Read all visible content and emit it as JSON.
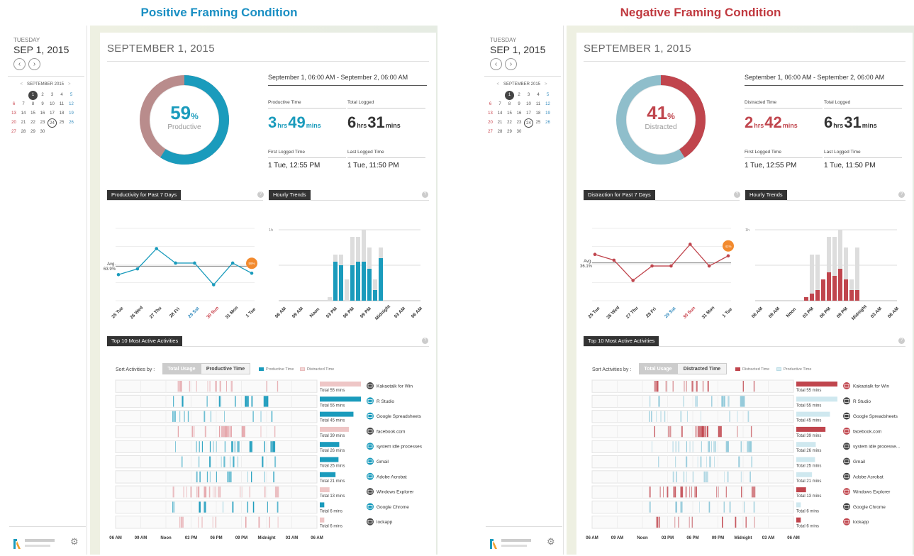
{
  "shared": {
    "day": "TUESDAY",
    "date": "SEP 1, 2015",
    "prev_icon": "‹",
    "next_icon": "›",
    "calendar": {
      "month_label": "SEPTEMBER 2015",
      "prev": "<",
      "next": ">",
      "today": 1,
      "selected": 24,
      "days": [
        1,
        2,
        3,
        4,
        5,
        6,
        7,
        8,
        9,
        10,
        11,
        12,
        13,
        14,
        15,
        16,
        17,
        18,
        19,
        20,
        21,
        22,
        23,
        24,
        25,
        26,
        27,
        28,
        29,
        30
      ],
      "start_col": 2
    },
    "main_title": "SEPTEMBER 1, 2015",
    "range": "September 1, 06:00 AM - September 2, 06:00 AM",
    "total_logged_label": "Total Logged",
    "total_logged": {
      "h": "6",
      "hl": "hrs",
      "m": "31",
      "ml": "mins"
    },
    "first_label": "First Logged Time",
    "first_value": "1 Tue, 12:55 PM",
    "last_label": "Last Logged Time",
    "last_value": "1 Tue, 11:50 PM",
    "hourly_title": "Hourly Trends",
    "top_title": "Top 10 Most Active Activities",
    "sort_label": "Sort Activities by :",
    "sort_total": "Total Usage",
    "week_days": [
      "25 Tue",
      "26 Wed",
      "27 Thu",
      "28 Fri",
      "29 Sat",
      "30 Sun",
      "31 Mon",
      "1 Tue"
    ],
    "hour_ticks": [
      "06 AM",
      "09 AM",
      "Noon",
      "03 PM",
      "06 PM",
      "09 PM",
      "Midnight",
      "03 AM",
      "06 AM"
    ],
    "hour_max_label": "1h",
    "help_icon": "?",
    "gear_icon": "⚙",
    "app_names": [
      "Kakaotalk for Win",
      "R Studio",
      "Google Spreadsheets",
      "facebook.com",
      "system idle processes",
      "Gmail",
      "Adobe Acrobat",
      "Windows Explorer",
      "Google Chrome",
      "lockapp"
    ],
    "app_names_negative_display": [
      "Kakaotalk for Win",
      "R Studio",
      "Google Spreadsheets",
      "facebook.com",
      "system idle processe...",
      "Gmail",
      "Adobe Acrobat",
      "Windows Explorer",
      "Google Chrome",
      "lockapp"
    ],
    "totals": [
      "Total 55 mins",
      "Total 55 mins",
      "Total 45 mins",
      "Total 39 mins",
      "Total 26 mins",
      "Total 25 mins",
      "Total 21 mins",
      "Total 13 mins",
      "Total 6 mins",
      "Total 6 mins"
    ],
    "app_productive": [
      false,
      true,
      true,
      false,
      true,
      true,
      true,
      false,
      true,
      false
    ]
  },
  "positive": {
    "condition_title": "Positive Framing Condition",
    "color": "#1a9bbc",
    "other_color": "#b98c8c",
    "pct": "59",
    "pct_label": "Productive",
    "primary_label": "Productive Time",
    "primary": {
      "h": "3",
      "hl": "hrs",
      "m": "49",
      "ml": "mins"
    },
    "week_title": "Productivity for Past 7 Days",
    "avg_label": "Avg.",
    "avg_value": "63.9%",
    "marker_label": "59%",
    "sort_alt": "Productive Time",
    "legend_main": "Productive Time",
    "legend_alt": "Distracted Time"
  },
  "negative": {
    "condition_title": "Negative Framing Condition",
    "color": "#c0454d",
    "other_color": "#8fbecb",
    "pct": "41",
    "pct_label": "Distracted",
    "primary_label": "Distracted Time",
    "primary": {
      "h": "2",
      "hl": "hrs",
      "m": "42",
      "ml": "mins"
    },
    "week_title": "Distraction for Past 7 Days",
    "avg_label": "Avg.",
    "avg_value": "36.1%",
    "marker_label": "41%",
    "sort_alt": "Distracted Time",
    "legend_main": "Distracted Time",
    "legend_alt": "Productive Time"
  },
  "chart_data": [
    {
      "type": "line",
      "title": "Productivity for Past 7 Days",
      "x": [
        "25 Tue",
        "26 Wed",
        "27 Thu",
        "28 Fri",
        "29 Sat",
        "30 Sun",
        "31 Mon",
        "1 Tue"
      ],
      "y": [
        58,
        62,
        76,
        66,
        66,
        51,
        66,
        59
      ],
      "ylim": [
        40,
        90
      ],
      "avg": 63.9
    },
    {
      "type": "line",
      "title": "Distraction for Past 7 Days",
      "x": [
        "25 Tue",
        "26 Wed",
        "27 Thu",
        "28 Fri",
        "29 Sat",
        "30 Sun",
        "31 Mon",
        "1 Tue"
      ],
      "y": [
        42,
        38,
        24,
        34,
        34,
        49,
        34,
        41
      ],
      "ylim": [
        10,
        60
      ],
      "avg": 36.1
    },
    {
      "type": "bar",
      "title": "Hourly Trends",
      "x_start_hour": 6,
      "x_labels": [
        "06 AM",
        "09 AM",
        "Noon",
        "03 PM",
        "06 PM",
        "09 PM",
        "Midnight",
        "03 AM",
        "06 AM"
      ],
      "series": [
        {
          "name": "Productive Time",
          "values": [
            0,
            0,
            0,
            0,
            0,
            0,
            0,
            0,
            0,
            0.55,
            0.5,
            0,
            0.5,
            0.55,
            0.55,
            0.45,
            0.15,
            0.6,
            0,
            0,
            0,
            0,
            0,
            0
          ]
        },
        {
          "name": "Distracted Time",
          "values": [
            0,
            0,
            0,
            0,
            0,
            0,
            0,
            0,
            0.05,
            0.1,
            0.15,
            0.3,
            0.4,
            0.35,
            0.45,
            0.3,
            0.15,
            0.15,
            0,
            0,
            0,
            0,
            0,
            0
          ]
        }
      ],
      "ylim": [
        0,
        1
      ]
    }
  ]
}
